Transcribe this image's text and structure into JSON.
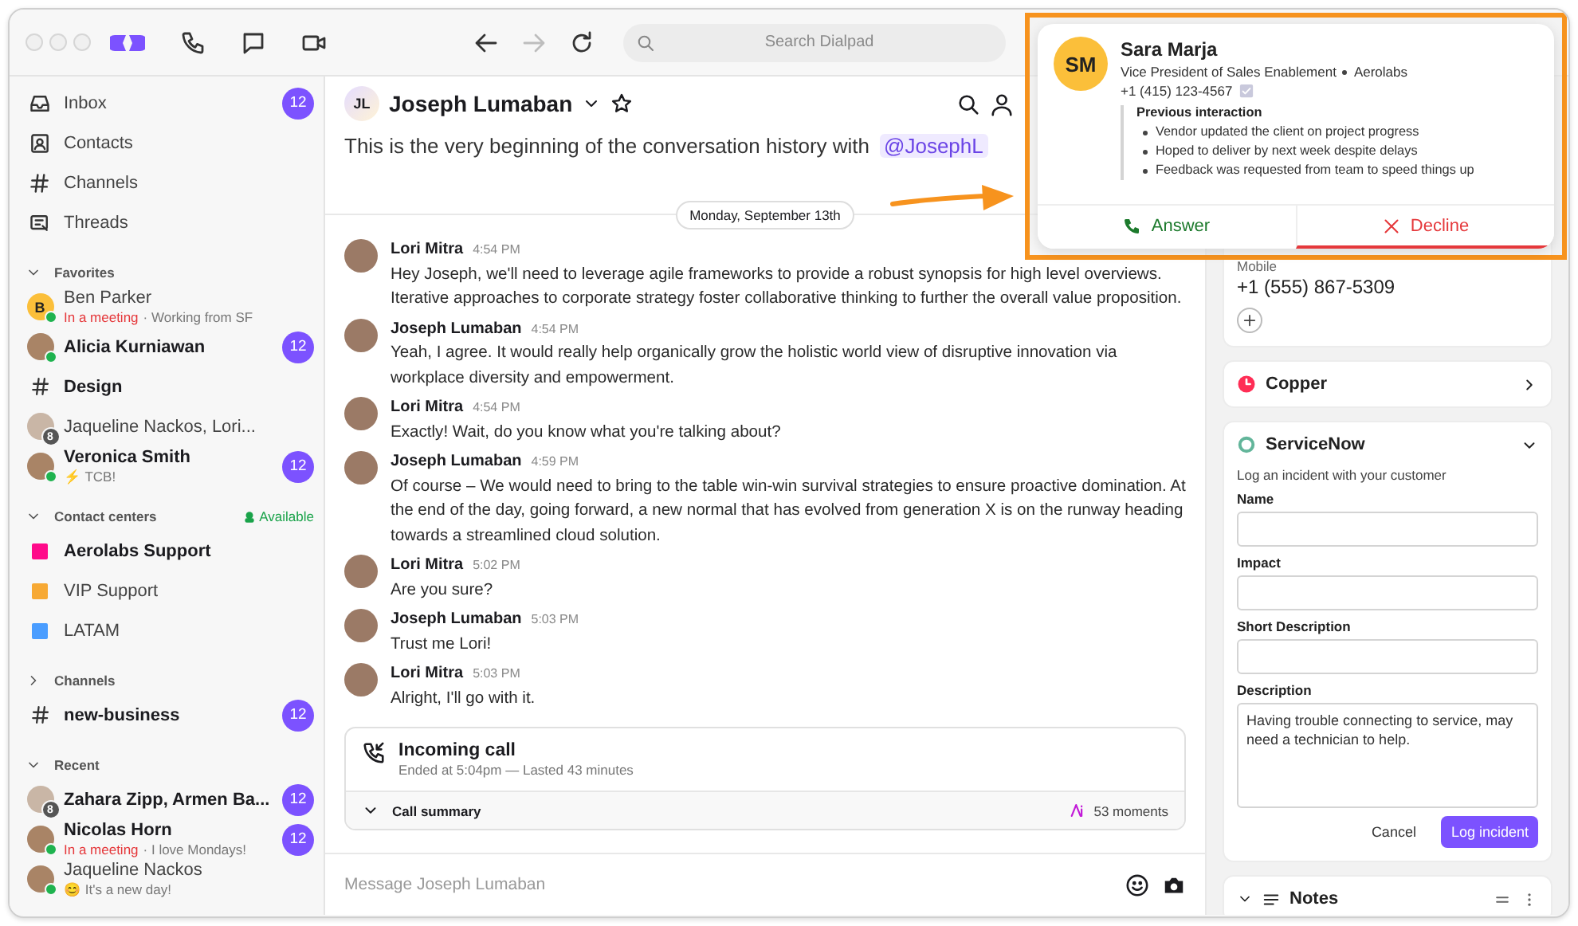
{
  "toolbar": {
    "search_placeholder": "Search Dialpad",
    "back_disabled": false,
    "forward_disabled": true
  },
  "sidebar": {
    "nav": [
      {
        "label": "Inbox",
        "badge": "12"
      },
      {
        "label": "Contacts"
      },
      {
        "label": "Channels"
      },
      {
        "label": "Threads"
      }
    ],
    "sections": [
      {
        "title": "Favorites",
        "expanded": true,
        "items": [
          {
            "kind": "contact",
            "avatar": {
              "kind": "initials",
              "text": "B"
            },
            "online": true,
            "name": "Ben Parker",
            "bold": false,
            "status": "In a meeting",
            "note": "· Working from SF"
          },
          {
            "kind": "contact",
            "avatar": {
              "kind": "photo"
            },
            "online": true,
            "name": "Alicia Kurniawan",
            "bold": true,
            "badge": "12"
          },
          {
            "kind": "channel",
            "name": "Design",
            "bold": true
          },
          {
            "kind": "contact",
            "avatar": {
              "kind": "group",
              "count": "8"
            },
            "online": false,
            "name": "Jaqueline Nackos, Lori...",
            "bold": false
          },
          {
            "kind": "contact",
            "avatar": {
              "kind": "photo"
            },
            "online": true,
            "name": "Veronica Smith",
            "bold": true,
            "note": "⚡ TCB!",
            "badge": "12"
          }
        ]
      },
      {
        "title": "Contact centers",
        "expanded": true,
        "availability": "Available",
        "items": [
          {
            "kind": "center",
            "color": "#ff0a8a",
            "name": "Aerolabs Support",
            "bold": true
          },
          {
            "kind": "center",
            "color": "#f7a934",
            "name": "VIP Support",
            "bold": false
          },
          {
            "kind": "center",
            "color": "#4a9dff",
            "name": "LATAM",
            "bold": false
          }
        ]
      },
      {
        "title": "Channels",
        "expanded": false,
        "items": [
          {
            "kind": "channel",
            "name": "new-business",
            "bold": true,
            "badge": "12"
          }
        ]
      },
      {
        "title": "Recent",
        "expanded": true,
        "items": [
          {
            "kind": "contact",
            "avatar": {
              "kind": "group",
              "count": "8"
            },
            "online": false,
            "name": "Zahara Zipp, Armen Ba...",
            "bold": true,
            "badge": "12"
          },
          {
            "kind": "contact",
            "avatar": {
              "kind": "photo"
            },
            "online": true,
            "name": "Nicolas Horn",
            "bold": true,
            "status": "In a meeting",
            "note": "· I love Mondays!",
            "badge": "12"
          },
          {
            "kind": "contact",
            "avatar": {
              "kind": "photo"
            },
            "online": true,
            "name": "Jaqueline Nackos",
            "bold": false,
            "note": "😊 It's a new day!"
          }
        ]
      }
    ]
  },
  "chat": {
    "header": {
      "initials": "JL",
      "name": "Joseph Lumaban",
      "starred": false
    },
    "intro": "This is the very beginning of the conversation history with",
    "mention": "@JosephL",
    "date": "Monday, September 13th",
    "messages": [
      {
        "author": "Lori Mitra",
        "time": "4:54 PM",
        "text": "Hey Joseph, we'll need to leverage agile frameworks to provide a robust synopsis for high level overviews. Iterative approaches to corporate strategy foster collaborative thinking to further the overall value proposition."
      },
      {
        "author": "Joseph Lumaban",
        "time": "4:54 PM",
        "text": "Yeah, I agree. It would really help organically grow the holistic world view of disruptive innovation via workplace diversity and empowerment."
      },
      {
        "author": "Lori Mitra",
        "time": "4:54 PM",
        "text": "Exactly! Wait, do you know what you're talking about?"
      },
      {
        "author": "Joseph Lumaban",
        "time": "4:59 PM",
        "text": "Of course – We would need to bring to the table win-win survival strategies to ensure proactive domination. At the end of the day, going forward, a new normal that has evolved from generation X is on the runway heading towards a streamlined cloud solution."
      },
      {
        "author": "Lori Mitra",
        "time": "5:02 PM",
        "text": "Are you sure?"
      },
      {
        "author": "Joseph Lumaban",
        "time": "5:03 PM",
        "text": "Trust me Lori!"
      },
      {
        "author": "Lori Mitra",
        "time": "5:03 PM",
        "text": "Alright, I'll go with it."
      }
    ],
    "call": {
      "title": "Incoming call",
      "detail": "Ended at 5:04pm — Lasted 43 minutes",
      "summary": "Call summary",
      "moments": "53 moments"
    },
    "composer_placeholder": "Message Joseph Lumaban"
  },
  "right_panel": {
    "contact": {
      "label": "Mobile",
      "phone": "+1 (555) 867-5309"
    },
    "copper": {
      "title": "Copper"
    },
    "servicenow": {
      "title": "ServiceNow",
      "expanded": true,
      "intro": "Log an incident with your customer",
      "fields": [
        {
          "kind": "input",
          "label": "Name"
        },
        {
          "kind": "input",
          "label": "Impact"
        },
        {
          "kind": "input",
          "label": "Short Description"
        },
        {
          "kind": "textarea",
          "label": "Description",
          "value": "Having trouble connecting to service, may need a technician to help."
        }
      ],
      "buttons": [
        {
          "kind": "secondary",
          "label": "Cancel"
        },
        {
          "kind": "primary",
          "label": "Log incident"
        }
      ]
    },
    "notes": {
      "title": "Notes",
      "expanded": true
    }
  },
  "incoming_call": {
    "initials": "SM",
    "name": "Sara Marja",
    "title": "Vice President of Sales Enablement",
    "company": "Aerolabs",
    "phone": "+1 (415) 123-4567",
    "history_title": "Previous interaction",
    "history": [
      "Vendor updated the client on project progress",
      "Hoped to deliver by next week despite delays",
      "Feedback was requested from team to speed things up"
    ],
    "actions": [
      {
        "kind": "answer",
        "label": "Answer",
        "selected": false
      },
      {
        "kind": "decline",
        "label": "Decline",
        "selected": true
      }
    ]
  }
}
